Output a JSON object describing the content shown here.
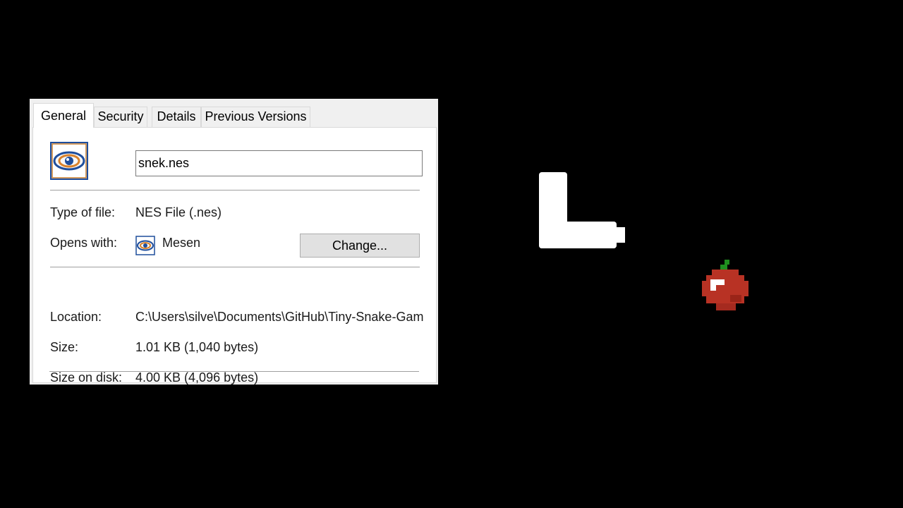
{
  "dialog": {
    "tabs": [
      {
        "label": "General",
        "active": true
      },
      {
        "label": "Security",
        "active": false
      },
      {
        "label": "Details",
        "active": false
      },
      {
        "label": "Previous Versions",
        "active": false
      }
    ],
    "file_icon": "mesen-eye-icon",
    "file_name": "snek.nes",
    "type_label": "Type of file:",
    "type_value": "NES File (.nes)",
    "opens_label": "Opens with:",
    "opens_app_icon": "mesen-eye-icon",
    "opens_value": "Mesen",
    "change_label": "Change...",
    "location_label": "Location:",
    "location_value": "C:\\Users\\silve\\Documents\\GitHub\\Tiny-Snake-Game",
    "size_label": "Size:",
    "size_value": "1.01 KB (1,040 bytes)",
    "size_disk_label": "Size on disk:",
    "size_disk_value": "4.00 KB (4,096 bytes)"
  },
  "game": {
    "background_color": "#000000",
    "snake_color": "#ffffff",
    "apple_color": "#c0392b",
    "apple_icon": "apple-icon",
    "snake_icon": "snake-body"
  }
}
